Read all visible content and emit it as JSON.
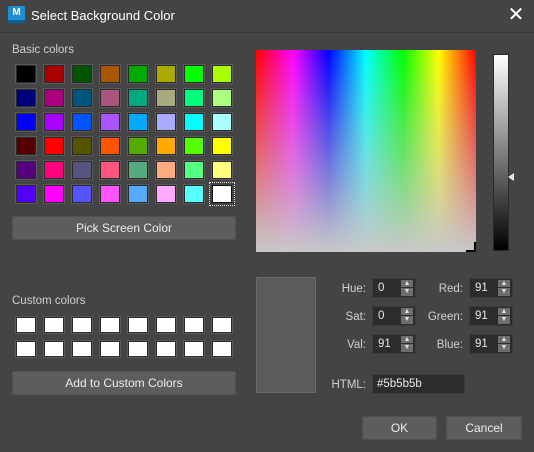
{
  "window": {
    "title": "Select Background Color",
    "app_icon_letter": "M",
    "close_icon": "close-icon"
  },
  "basic_colors": {
    "label": "Basic colors",
    "swatches": [
      [
        "#000000",
        "#aa0000",
        "#005500",
        "#aa5500",
        "#00aa00",
        "#aaaa00",
        "#00ff00",
        "#aaff00"
      ],
      [
        "#00007f",
        "#aa007f",
        "#00557f",
        "#aa557f",
        "#00aa7f",
        "#aaaa7f",
        "#00ff7f",
        "#aaff7f"
      ],
      [
        "#0000ff",
        "#aa00ff",
        "#0055ff",
        "#aa55ff",
        "#00aaff",
        "#aaaaff",
        "#00ffff",
        "#aaffff"
      ],
      [
        "#550000",
        "#ff0000",
        "#555500",
        "#ff5500",
        "#55aa00",
        "#ffaa00",
        "#55ff00",
        "#ffff00"
      ],
      [
        "#55007f",
        "#ff007f",
        "#55557f",
        "#ff557f",
        "#55aa7f",
        "#ffaa7f",
        "#55ff7f",
        "#ffff7f"
      ],
      [
        "#5500ff",
        "#ff00ff",
        "#5555ff",
        "#ff55ff",
        "#55aaff",
        "#ffaaff",
        "#55ffff",
        "#ffffff"
      ]
    ],
    "selected": "#ffffff"
  },
  "pick_screen_color_label": "Pick Screen Color",
  "custom_colors": {
    "label": "Custom colors",
    "swatches": [
      "#ffffff",
      "#ffffff",
      "#ffffff",
      "#ffffff",
      "#ffffff",
      "#ffffff",
      "#ffffff",
      "#ffffff",
      "#ffffff",
      "#ffffff",
      "#ffffff",
      "#ffffff",
      "#ffffff",
      "#ffffff",
      "#ffffff",
      "#ffffff"
    ]
  },
  "add_custom_label": "Add to Custom Colors",
  "preview_color": "#5b5b5b",
  "fields": {
    "hue": {
      "label": "Hue:",
      "value": "0"
    },
    "sat": {
      "label": "Sat:",
      "value": "0"
    },
    "val": {
      "label": "Val:",
      "value": "91"
    },
    "red": {
      "label": "Red:",
      "value": "91"
    },
    "green": {
      "label": "Green:",
      "value": "91"
    },
    "blue": {
      "label": "Blue:",
      "value": "91"
    },
    "html": {
      "label": "HTML:",
      "value": "#5b5b5b"
    }
  },
  "buttons": {
    "ok": "OK",
    "cancel": "Cancel"
  }
}
